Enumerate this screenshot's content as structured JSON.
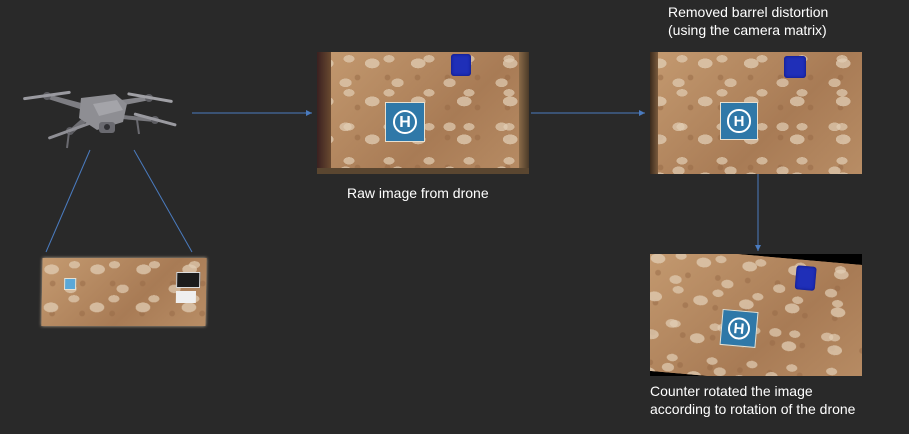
{
  "captions": {
    "raw": "Raw image from drone",
    "undistorted_line1": "Removed barrel distortion",
    "undistorted_line2": "(using the camera matrix)",
    "rotated_line1": "Counter rotated the image",
    "rotated_line2": "according to rotation of the drone"
  },
  "helipad_letter": "H",
  "colors": {
    "background": "#292929",
    "arrow": "#4a7bbf",
    "helipad": "#2f78a8",
    "floor": "#b58a62",
    "object": "#1f2fb8"
  }
}
